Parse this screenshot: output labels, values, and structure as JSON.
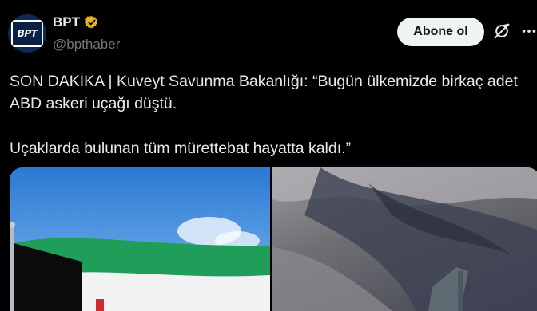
{
  "tweet": {
    "author": {
      "display_name": "BPT",
      "handle": "@bpthaber",
      "avatar_text": "BPT",
      "verified_color": "#e2b719",
      "avatar_icon": "bpt-logo-icon"
    },
    "follow_label": "Abone ol",
    "text": "SON DAKİKA | Kuveyt Savunma Bakanlığı: “Bugün ülkemizde birkaç adet ABD askeri uçağı düştü.\n\nUçaklarda bulunan tüm mürettebat hayatta kaldı.”",
    "media": [
      {
        "icon": "kuwait-flag-image"
      },
      {
        "icon": "aerial-aircraft-image"
      }
    ]
  },
  "colors": {
    "background": "#000000",
    "text": "#e7e9ea",
    "secondary_text": "#71767b",
    "button_bg": "#eff3f4",
    "button_text": "#0f1419"
  }
}
